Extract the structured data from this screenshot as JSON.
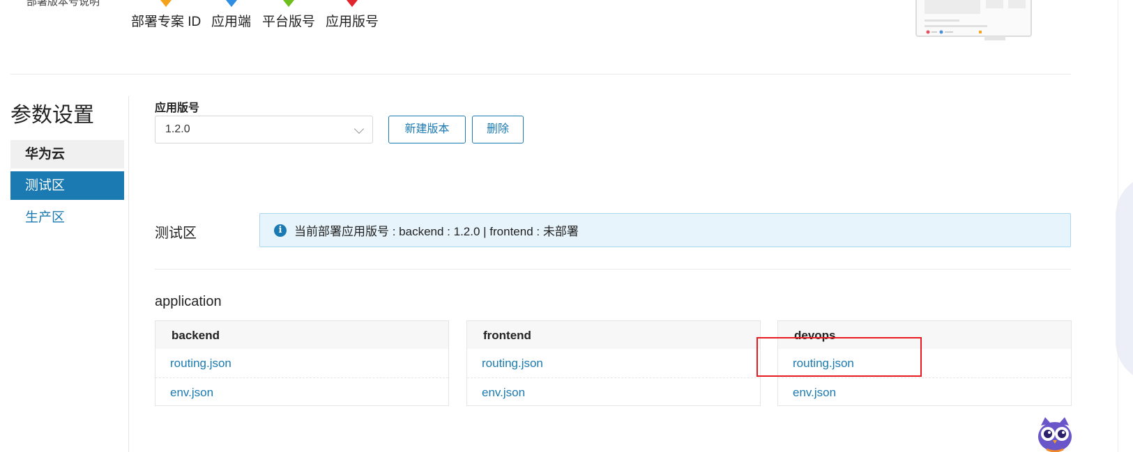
{
  "header": {
    "cut_title": "部署版本号说明",
    "legend": [
      {
        "label": "部署专案 ID",
        "color": "#f5a21b"
      },
      {
        "label": "应用端",
        "color": "#2f8de4"
      },
      {
        "label": "平台版号",
        "color": "#6fbf1c"
      },
      {
        "label": "应用版号",
        "color": "#e0252d"
      }
    ]
  },
  "sidebar": {
    "title": "参数设置",
    "items": [
      {
        "label": "华为云",
        "state": "group"
      },
      {
        "label": "测试区",
        "state": "active"
      },
      {
        "label": "生产区",
        "state": "normal"
      }
    ]
  },
  "version": {
    "label": "应用版号",
    "selected": "1.2.0",
    "new_button": "新建版本",
    "delete_button": "删除"
  },
  "zone": {
    "label": "测试区",
    "info": "当前部署应用版号 : backend : 1.2.0 | frontend : 未部署"
  },
  "application": {
    "title": "application",
    "cards": [
      {
        "name": "backend",
        "files": [
          "routing.json",
          "env.json"
        ]
      },
      {
        "name": "frontend",
        "files": [
          "routing.json",
          "env.json"
        ]
      },
      {
        "name": "devops",
        "files": [
          "routing.json",
          "env.json"
        ]
      }
    ]
  },
  "colors": {
    "accent": "#1a7ab1",
    "info_bg": "#e7f4fb",
    "highlight": "#e8191f"
  }
}
